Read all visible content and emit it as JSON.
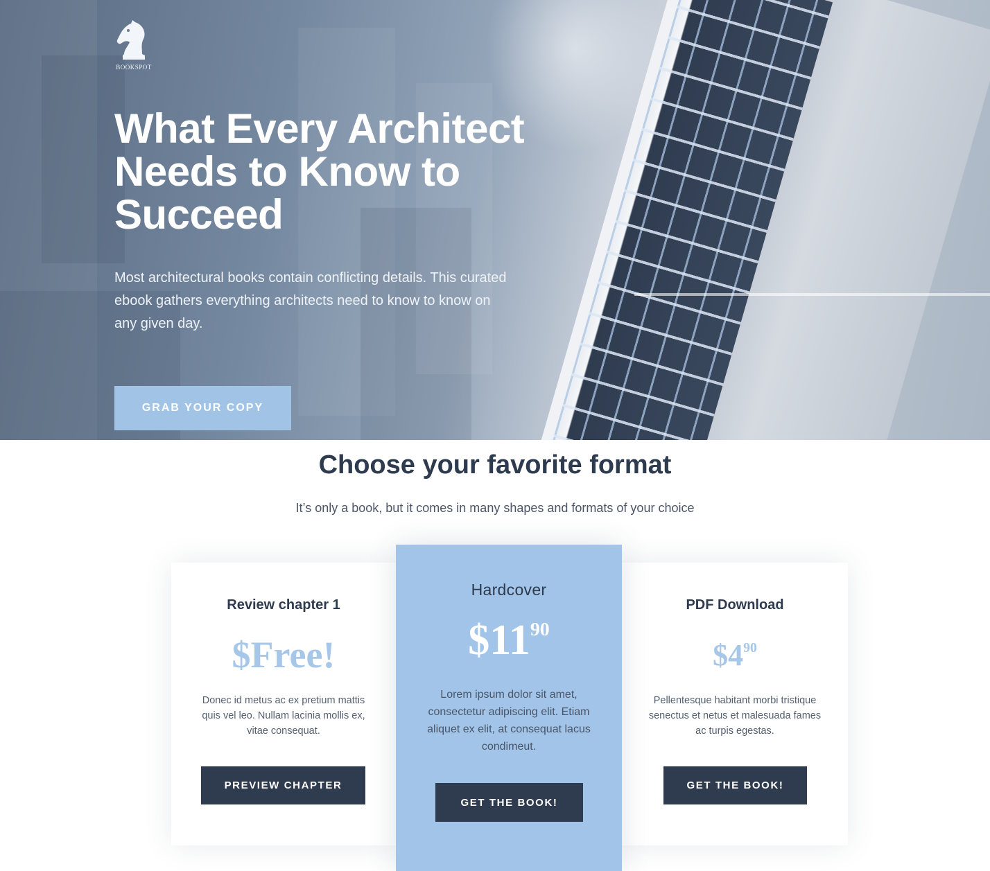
{
  "brand": {
    "logo_text": "BOOKSPOT",
    "logo_icon": "chess-knight-icon"
  },
  "hero": {
    "title": "What Every Architect Needs to Know to Succeed",
    "description": "Most architectural books contain conflicting details. This curated ebook gathers everything architects need to know to know on any given day.",
    "cta_label": "GRAB YOUR COPY"
  },
  "formats": {
    "title": "Choose your favorite format",
    "subtitle": "It’s only a book, but it comes in many shapes and formats of your choice",
    "cards": [
      {
        "title": "Review chapter 1",
        "price_main": "$Free!",
        "price_cents": "",
        "description": "Donec id metus ac ex pretium mattis quis vel leo. Nullam lacinia mollis ex, vitae consequat.",
        "button_label": "PREVIEW CHAPTER"
      },
      {
        "title": "Hardcover",
        "price_main": "$11",
        "price_cents": "90",
        "description": "Lorem ipsum dolor sit amet, consectetur adipiscing elit. Etiam aliquet ex elit, at consequat lacus condimeut.",
        "button_label": "GET THE BOOK!"
      },
      {
        "title": "PDF Download",
        "price_main": "$4",
        "price_cents": "90",
        "description": "Pellentesque habitant morbi tristique senectus et netus et malesuada fames ac turpis egestas.",
        "button_label": "GET THE BOOK!"
      }
    ]
  },
  "colors": {
    "accent": "#a0c3e6",
    "dark_button": "#2f3b4f",
    "heading": "#2e3a4e"
  }
}
